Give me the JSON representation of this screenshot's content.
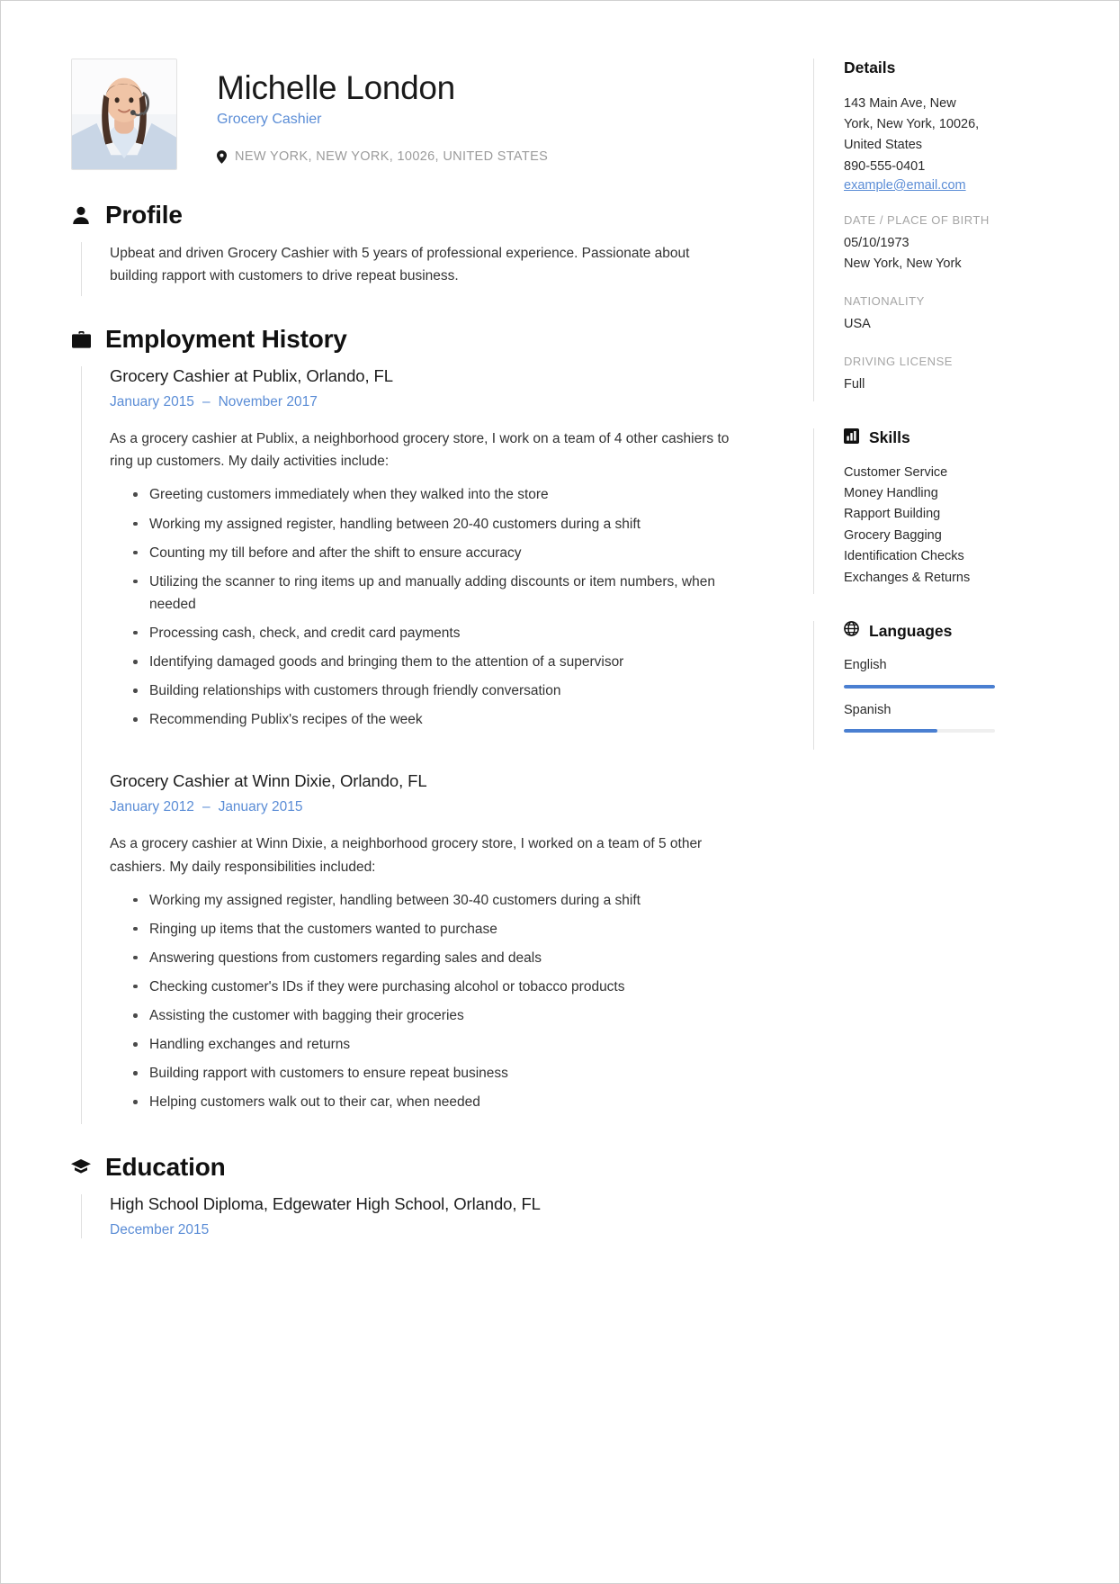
{
  "header": {
    "name": "Michelle London",
    "job_title": "Grocery Cashier",
    "location": "NEW YORK, NEW YORK, 10026, UNITED STATES",
    "photo_alt": "profile-photo"
  },
  "colors": {
    "accent_blue": "#5b8dd6",
    "bar_blue": "#4a7fd1",
    "muted_gray": "#a5a5a5",
    "text": "#333333",
    "rule": "#e0e0e0"
  },
  "sections": {
    "profile": {
      "heading": "Profile",
      "icon": "person-icon",
      "text": "Upbeat and driven Grocery Cashier with 5 years of professional experience. Passionate about building rapport with customers to drive repeat business."
    },
    "employment": {
      "heading": "Employment History",
      "icon": "briefcase-icon",
      "jobs": [
        {
          "title": "Grocery Cashier at Publix, Orlando, FL",
          "start": "January 2015",
          "dash": "–",
          "end": "November 2017",
          "description": "As a grocery cashier at Publix, a neighborhood grocery store, I work on a team of 4 other cashiers to ring up customers. My daily activities include:",
          "bullets": [
            "Greeting customers immediately when they walked into the store",
            "Working my assigned register, handling between 20-40 customers during a shift",
            "Counting my till before and after the shift to ensure accuracy",
            "Utilizing the scanner to ring items up and manually adding discounts or item numbers, when needed",
            "Processing cash, check, and credit card payments",
            "Identifying damaged goods and bringing them to the attention of a supervisor",
            "Building relationships with customers through friendly conversation",
            "Recommending Publix's recipes of the week"
          ]
        },
        {
          "title": "Grocery Cashier at Winn Dixie, Orlando, FL",
          "start": "January 2012",
          "dash": "–",
          "end": "January 2015",
          "description": "As a grocery cashier at Winn Dixie, a neighborhood grocery store, I worked on a team of 5 other cashiers. My daily responsibilities included:",
          "bullets": [
            "Working my assigned register, handling between 30-40 customers during a shift",
            "Ringing up items that the customers wanted to purchase",
            "Answering questions from customers regarding sales and deals",
            "Checking customer's IDs if they were purchasing alcohol or tobacco products",
            "Assisting the customer with bagging their groceries",
            "Handling exchanges and returns",
            "Building rapport with customers to ensure repeat business",
            "Helping customers walk out to their car, when needed"
          ]
        }
      ]
    },
    "education": {
      "heading": "Education",
      "icon": "graduation-cap-icon",
      "entries": [
        {
          "title": "High School Diploma, Edgewater High School, Orlando, FL",
          "date": "December 2015"
        }
      ]
    }
  },
  "sidebar": {
    "details": {
      "heading": "Details",
      "address_lines": [
        "143 Main Ave, New",
        "York, New York, 10026,",
        "United States"
      ],
      "phone": "890-555-0401",
      "email": "example@email.com",
      "fields": [
        {
          "label": "DATE / PLACE OF BIRTH",
          "values": [
            "05/10/1973",
            "New York, New York"
          ]
        },
        {
          "label": "NATIONALITY",
          "values": [
            "USA"
          ]
        },
        {
          "label": "DRIVING LICENSE",
          "values": [
            "Full"
          ]
        }
      ]
    },
    "skills": {
      "heading": "Skills",
      "icon": "bar-chart-icon",
      "items": [
        "Customer Service",
        "Money Handling",
        "Rapport Building",
        "Grocery Bagging",
        "Identification Checks",
        "Exchanges & Returns"
      ]
    },
    "languages": {
      "heading": "Languages",
      "icon": "globe-icon",
      "items": [
        {
          "name": "English",
          "level_percent": 100
        },
        {
          "name": "Spanish",
          "level_percent": 62
        }
      ]
    }
  }
}
